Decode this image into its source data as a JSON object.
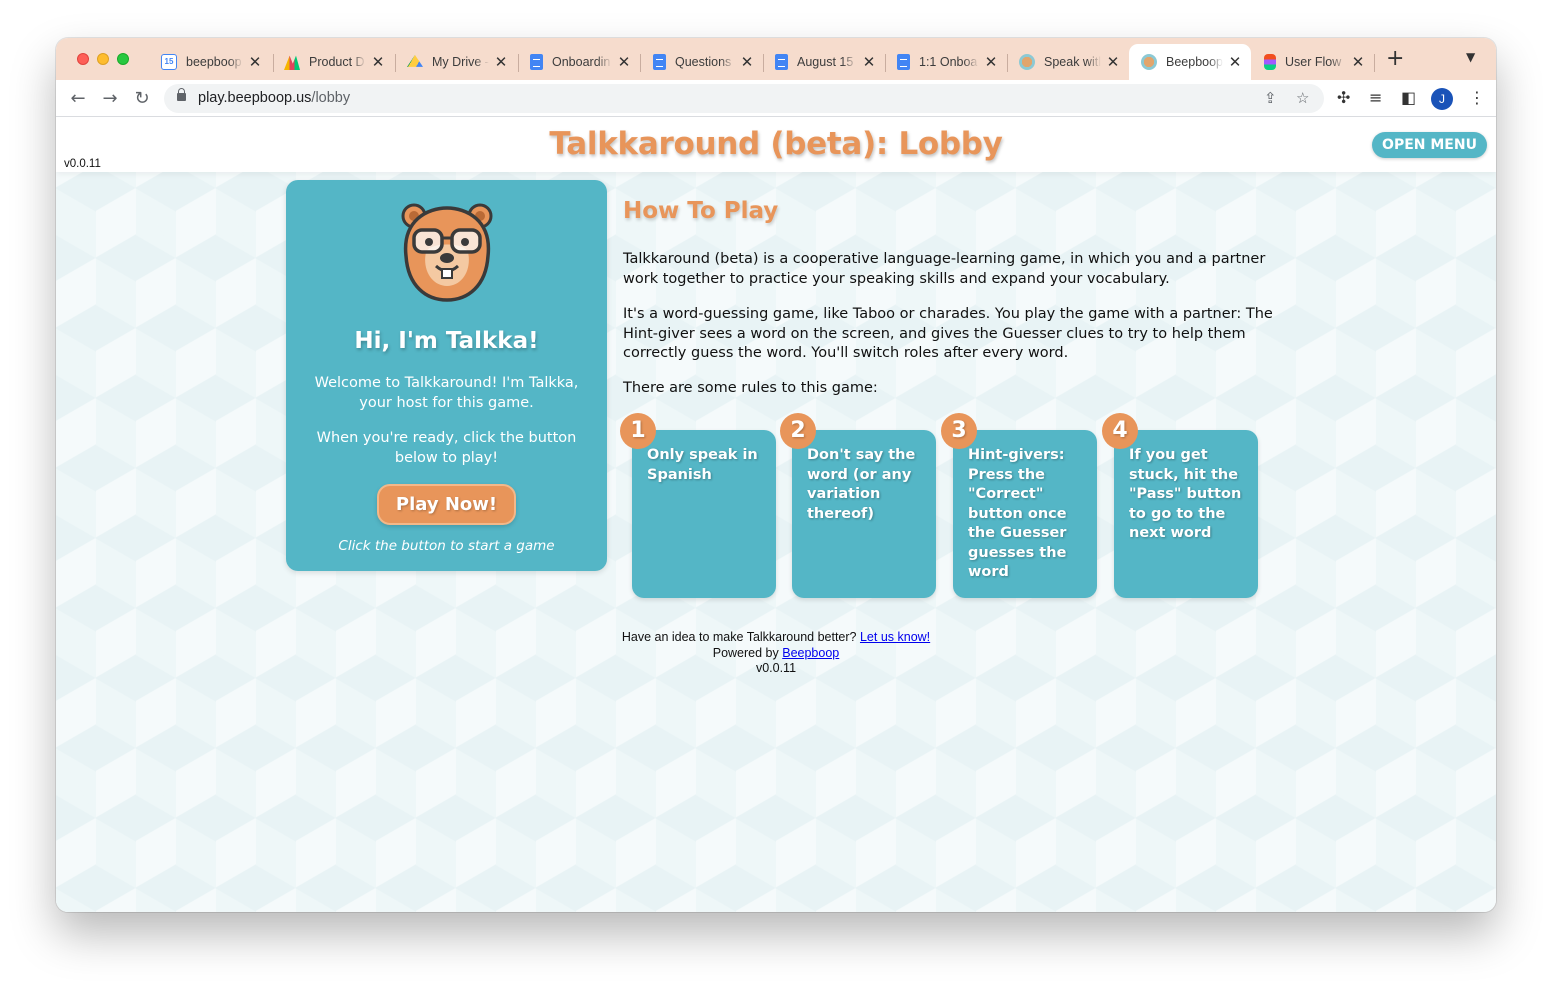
{
  "browser": {
    "tabs": [
      {
        "title": "beepboop",
        "favicon": "calendar-icon"
      },
      {
        "title": "Product D",
        "favicon": "product-icon"
      },
      {
        "title": "My Drive -",
        "favicon": "drive-icon"
      },
      {
        "title": "Onboardin",
        "favicon": "docs-icon"
      },
      {
        "title": "Questions",
        "favicon": "docs-icon"
      },
      {
        "title": "August 15",
        "favicon": "docs-icon"
      },
      {
        "title": "1:1 Onboa",
        "favicon": "docs-icon"
      },
      {
        "title": "Speak witl",
        "favicon": "beepboop-icon"
      },
      {
        "title": "Beepboop",
        "favicon": "beepboop-icon",
        "active": true
      },
      {
        "title": "User Flow",
        "favicon": "figma-icon"
      }
    ],
    "calendar_day": "15",
    "url_host": "play.beepboop.us",
    "url_path": "/lobby",
    "profile_initial": "J"
  },
  "app": {
    "version_top": "v0.0.11",
    "title": "Talkkaround (beta): Lobby",
    "open_menu": "OPEN MENU"
  },
  "intro": {
    "title": "Hi, I'm Talkka!",
    "welcome": "Welcome to Talkkaround! I'm Talkka, your host for this game.",
    "ready": "When you're ready, click the button below to play!",
    "play_button": "Play Now!",
    "hint": "Click the button to start a game"
  },
  "how_to_play": {
    "title": "How To Play",
    "para1": "Talkkaround (beta) is a cooperative language-learning game, in which you and a partner work together to practice your speaking skills and expand your vocabulary.",
    "para2": "It's a word-guessing game, like Taboo or charades. You play the game with a partner: The Hint-giver sees a word on the screen, and gives the Guesser clues to try to help them correctly guess the word. You'll switch roles after every word.",
    "para3": "There are some rules to this game:",
    "rules": [
      {
        "num": "1",
        "text": "Only speak in Spanish"
      },
      {
        "num": "2",
        "text": "Don't say the word (or any variation thereof)"
      },
      {
        "num": "3",
        "text": "Hint-givers: Press the \"Correct\" button once the Guesser guesses the word"
      },
      {
        "num": "4",
        "text": "If you get stuck, hit the \"Pass\" button to go to the next word"
      }
    ]
  },
  "footer": {
    "idea_text": "Have an idea to make Talkkaround better?",
    "idea_link": "Let us know!",
    "powered_text": "Powered by",
    "powered_link": "Beepboop",
    "version": "v0.0.11"
  },
  "colors": {
    "accent_teal": "#54b6c6",
    "accent_orange": "#e8955a",
    "tabstrip": "#f6dccd"
  }
}
